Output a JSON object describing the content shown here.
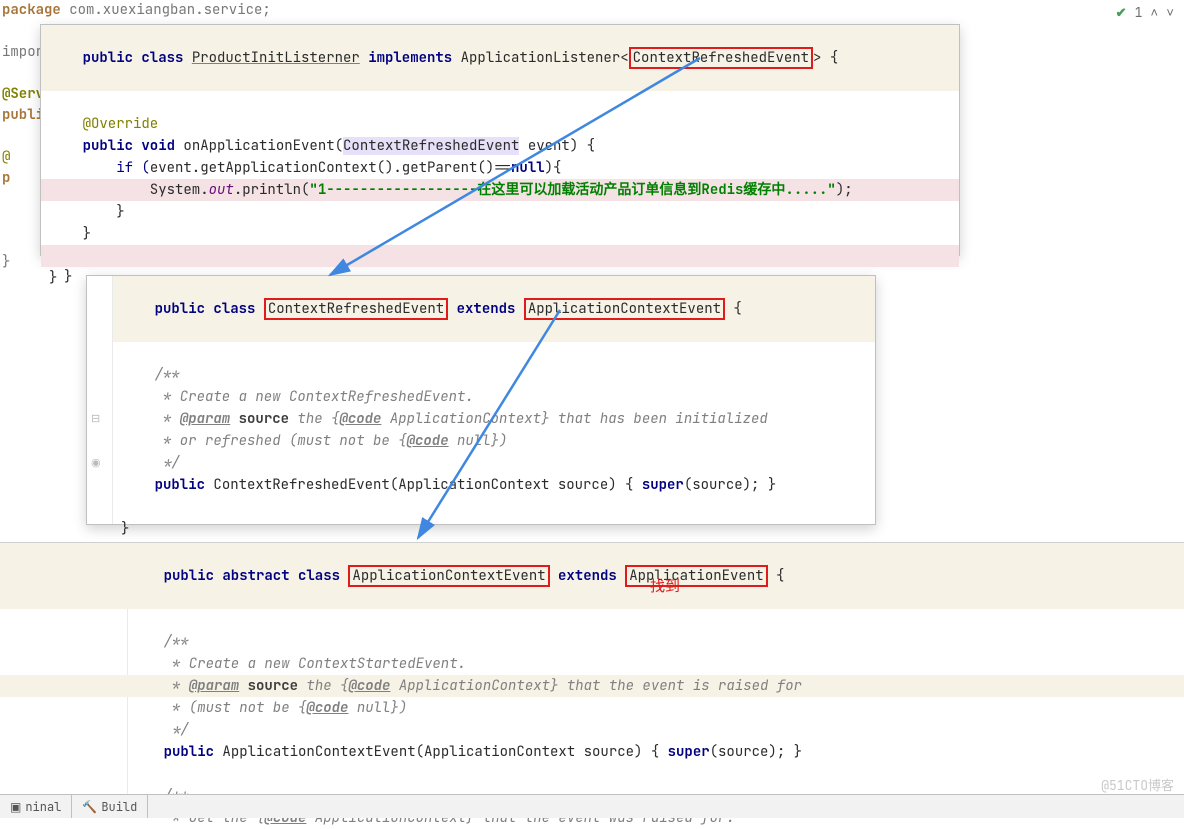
{
  "header": {
    "package_kw": "package ",
    "package_name": "com.xuexiangban.service;"
  },
  "bg": {
    "line2a": "impor",
    "line4a": "@Serv",
    "line5a": "publi",
    "line6": "    @",
    "line7": "    p",
    "bracket": "    }"
  },
  "inspection": {
    "count": "1"
  },
  "panel1": {
    "l1_pre": "public class ",
    "l1_name": "ProductInitListerner",
    "l1_mid": " implements ",
    "l1_iface": "ApplicationListener",
    "l1_gen_open": "<",
    "l1_event": "ContextRefreshedEvent",
    "l1_gen_close": ">",
    "l1_brace": " {",
    "override": "@Override",
    "l4_pre": "public void ",
    "l4_name": "onApplicationEvent(",
    "l4_param_type": "ContextRefreshedEvent",
    "l4_param": " event) {",
    "l5_pre": "        if (",
    "l5_body": "event.getApplicationContext().getParent()==",
    "l5_null": "null",
    "l5_end": "){",
    "l6_pre": "            System.",
    "l6_out": "out",
    "l6_call": ".println(",
    "l6_str": "\"1------------------在这里可以加载活动产品订单信息到Redis缓存中.....\"",
    "l6_end": ");",
    "brace_c1": "        }",
    "brace_c2": "    }",
    "brace_c3": "}"
  },
  "panel2": {
    "l1_pre": "public class ",
    "l1_name": "ContextRefreshedEvent",
    "l1_ext": " extends ",
    "l1_super": "ApplicationContextEvent",
    "l1_brace": " {",
    "c1": "/**",
    "c2": " * Create a new ContextRefreshedEvent.",
    "c3a": " * ",
    "c3_tag": "@param",
    "c3b": " ",
    "c3_name": "source",
    "c3c": " the {",
    "c3_code": "@code",
    "c3d": " ApplicationContext} that has been initialized",
    "c4": " * or refreshed (must not be {",
    "c4_code": "@code",
    "c4b": " null})",
    "c5": " */",
    "ctor_pre": "public ",
    "ctor_name": "ContextRefreshedEvent(ApplicationContext source) { ",
    "ctor_super": "super",
    "ctor_end": "(source); }",
    "brace": "}"
  },
  "panel3": {
    "l1_pre": "public abstract class ",
    "l1_name": "ApplicationContextEvent",
    "l1_ext": " extends ",
    "l1_super": "ApplicationEvent",
    "l1_brace": " {",
    "c1": "/**",
    "c2": " * Create a new ContextStartedEvent.",
    "c3a": " * ",
    "c3_tag": "@param",
    "c3b": " ",
    "c3_name": "source",
    "c3c": " the {",
    "c3_code": "@code",
    "c3d": " ApplicationContext} that the event is raised for",
    "c4": " * (must not be {",
    "c4_code": "@code",
    "c4b": " null})",
    "c5": " */",
    "ctor_pre": "public ",
    "ctor_name": "ApplicationContextEvent(ApplicationContext source) { ",
    "ctor_super": "super",
    "ctor_end": "(source); }",
    "g1": "/**",
    "g2a": " * Get the {",
    "g2_code": "@code",
    "g2b": " ApplicationContext} that the event was raised for."
  },
  "found_label": "找到",
  "bottom": {
    "terminal": "ninal",
    "build": "Build"
  },
  "watermark": "@51CTO博客"
}
